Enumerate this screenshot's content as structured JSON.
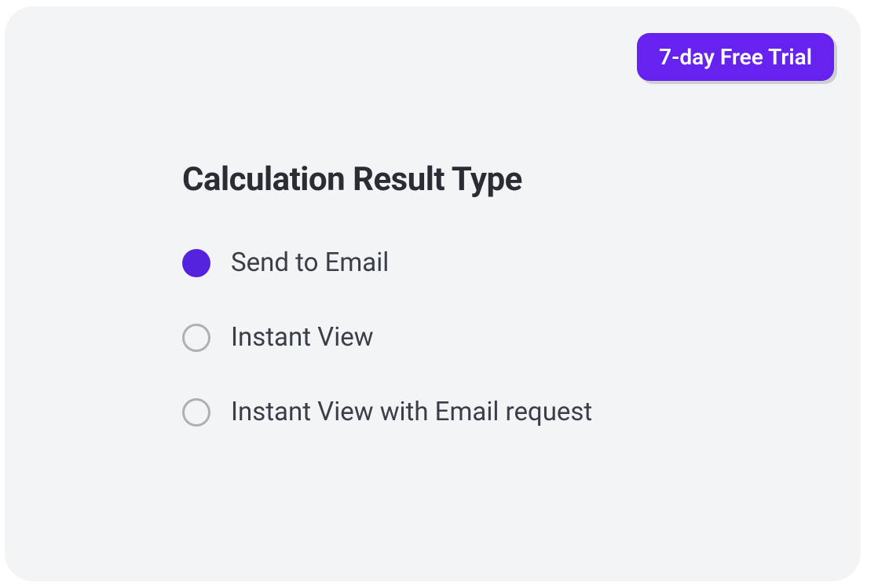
{
  "trial_badge": {
    "label": "7-day Free Trial"
  },
  "heading": "Calculation Result Type",
  "options": [
    {
      "label": "Send to Email",
      "selected": true
    },
    {
      "label": "Instant View",
      "selected": false
    },
    {
      "label": "Instant View with Email request",
      "selected": false
    }
  ],
  "colors": {
    "accent": "#6622ee",
    "radio_selected": "#5522dd",
    "card_bg": "#f3f4f6",
    "text_heading": "#2a2e34",
    "text_body": "#3a3f47",
    "radio_border": "#adb0b6"
  }
}
